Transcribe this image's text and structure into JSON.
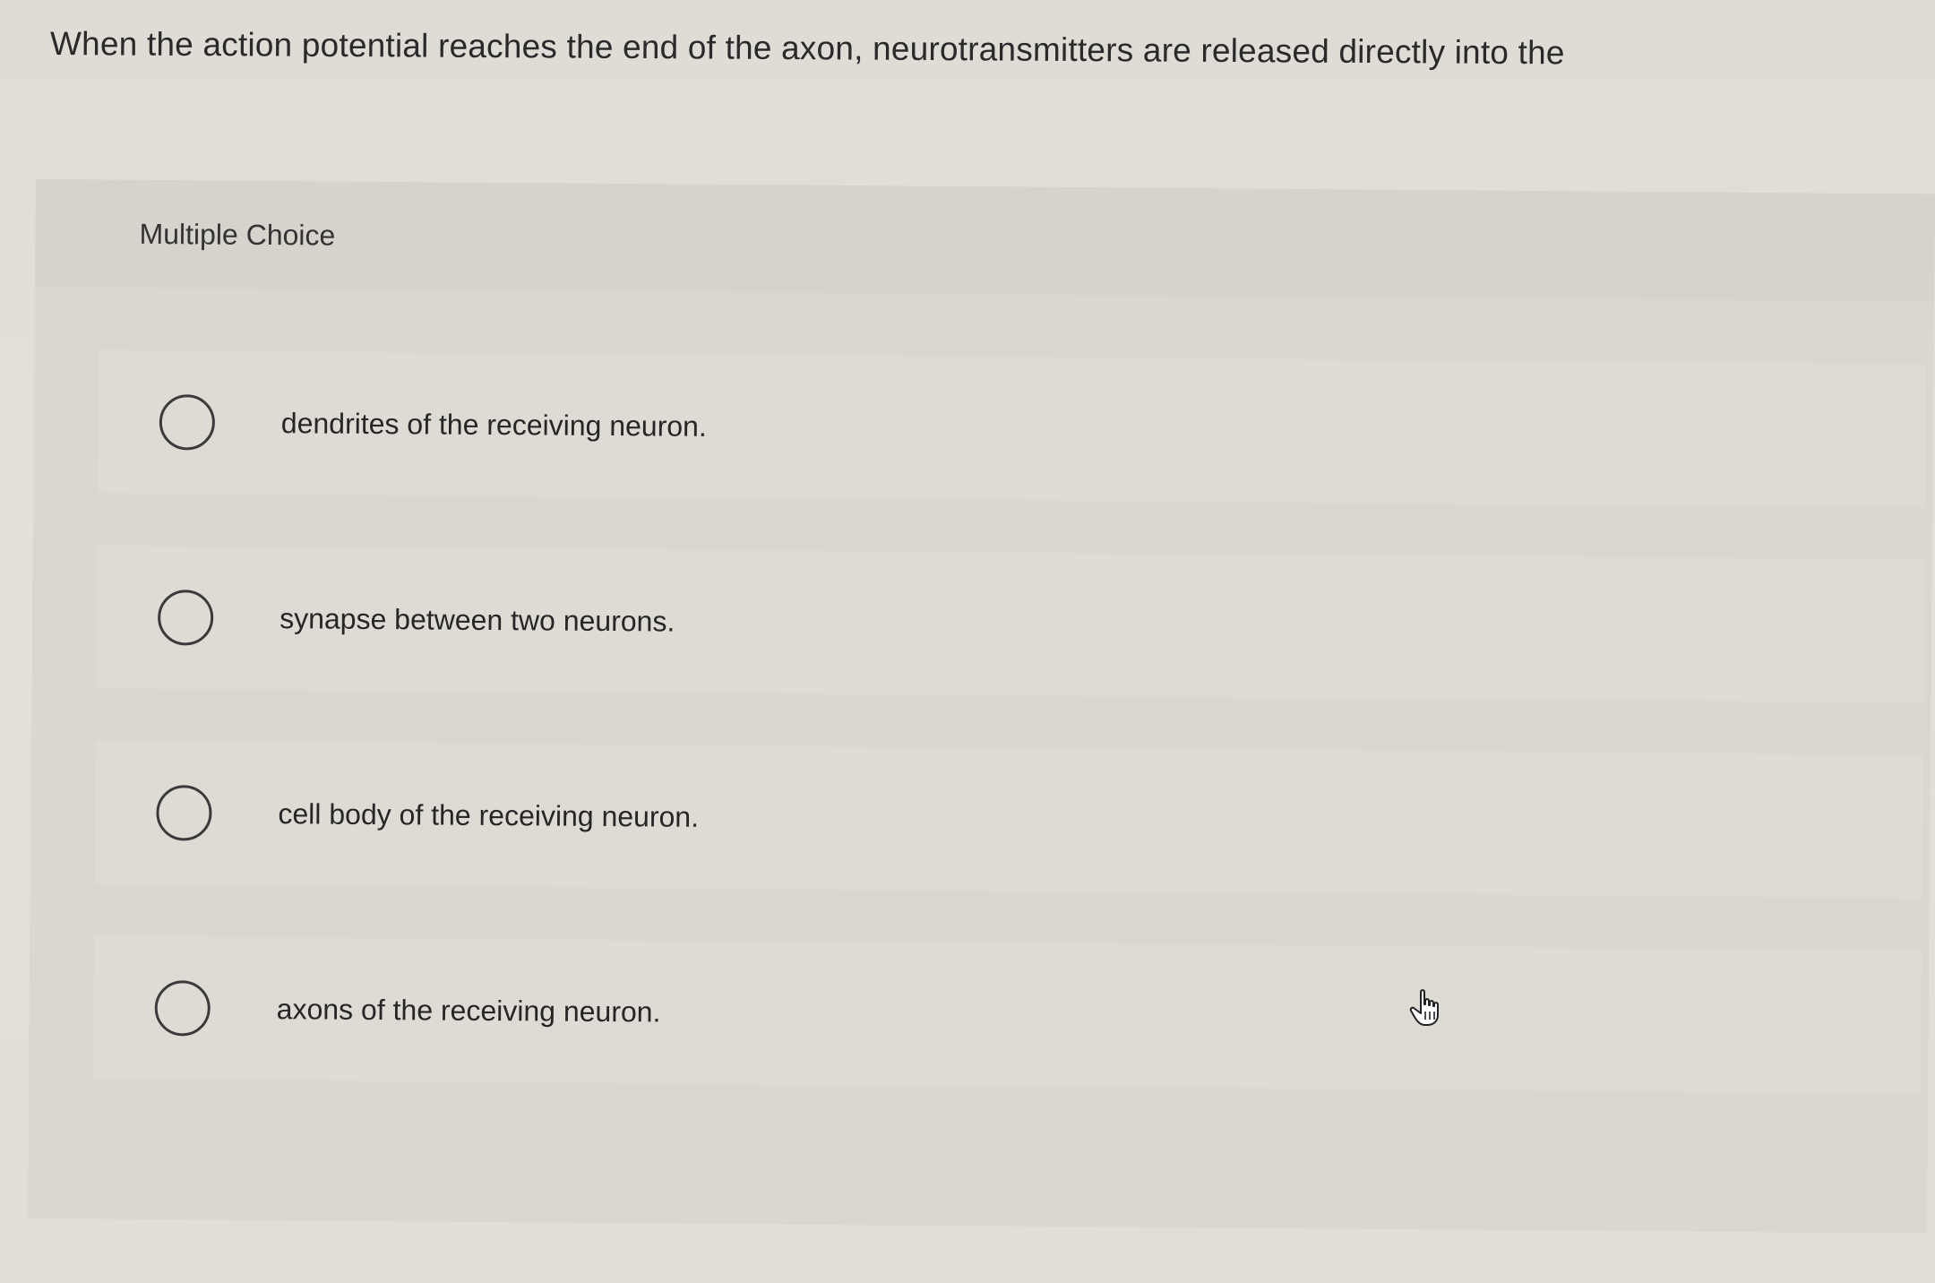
{
  "question": {
    "text": "When the action potential reaches the end of the axon, neurotransmitters are released directly into the"
  },
  "panel": {
    "title": "Multiple Choice"
  },
  "options": [
    {
      "label": "dendrites of the receiving neuron."
    },
    {
      "label": "synapse between two neurons."
    },
    {
      "label": "cell body of the receiving neuron."
    },
    {
      "label": "axons of the receiving neuron."
    }
  ],
  "cursor": {
    "icon": "hand-pointer-icon"
  }
}
